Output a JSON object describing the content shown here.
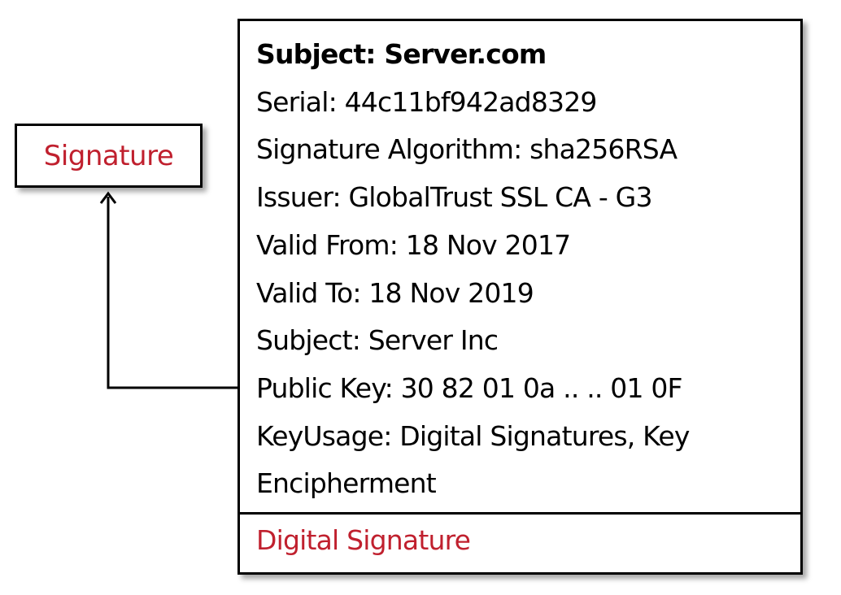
{
  "signature_box": {
    "label": "Signature"
  },
  "certificate": {
    "fields": [
      {
        "text": "Subject: Server.com",
        "bold": true
      },
      {
        "text": "Serial: 44c11bf942ad8329",
        "bold": false
      },
      {
        "text": "Signature Algorithm: sha256RSA",
        "bold": false
      },
      {
        "text": "Issuer: GlobalTrust SSL CA - G3",
        "bold": false
      },
      {
        "text": "Valid From: 18 Nov 2017",
        "bold": false
      },
      {
        "text": "Valid To: 18 Nov 2019",
        "bold": false
      },
      {
        "text": "Subject: Server Inc",
        "bold": false
      },
      {
        "text": "Public Key: 30 82 01 0a .. .. 01 0F",
        "bold": false
      },
      {
        "text": "KeyUsage: Digital Signatures, Key",
        "bold": false
      },
      {
        "text": "Encipherment",
        "bold": false
      }
    ],
    "digital_signature_label": "Digital Signature"
  },
  "colors": {
    "accent_red": "#c0202e",
    "border": "#000000",
    "text": "#000000"
  }
}
